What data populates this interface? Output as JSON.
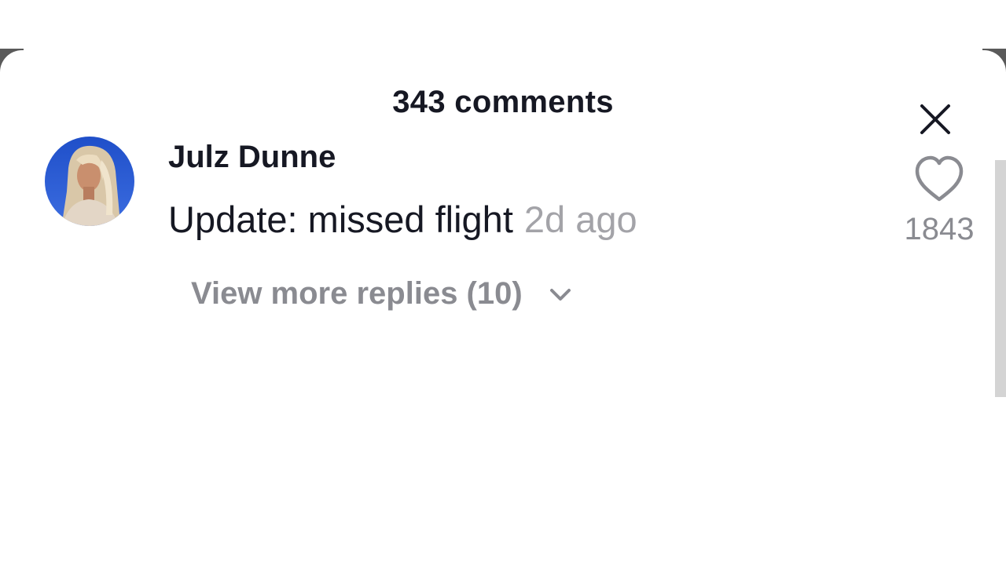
{
  "sheet": {
    "title": "343 comments",
    "close_icon": "close-icon"
  },
  "comment": {
    "author": "Julz Dunne",
    "text": "Update: missed flight",
    "timestamp": "2d ago",
    "replies_label": "View more replies (10)",
    "replies_icon": "chevron-down-icon",
    "like_icon": "heart-outline-icon",
    "like_count": "1843"
  },
  "colors": {
    "text_primary": "#161823",
    "text_secondary": "#8a8b91",
    "timestamp": "#a3a3a8",
    "backdrop": "#5a5a5a",
    "scrollbar": "#d4d4d4"
  }
}
